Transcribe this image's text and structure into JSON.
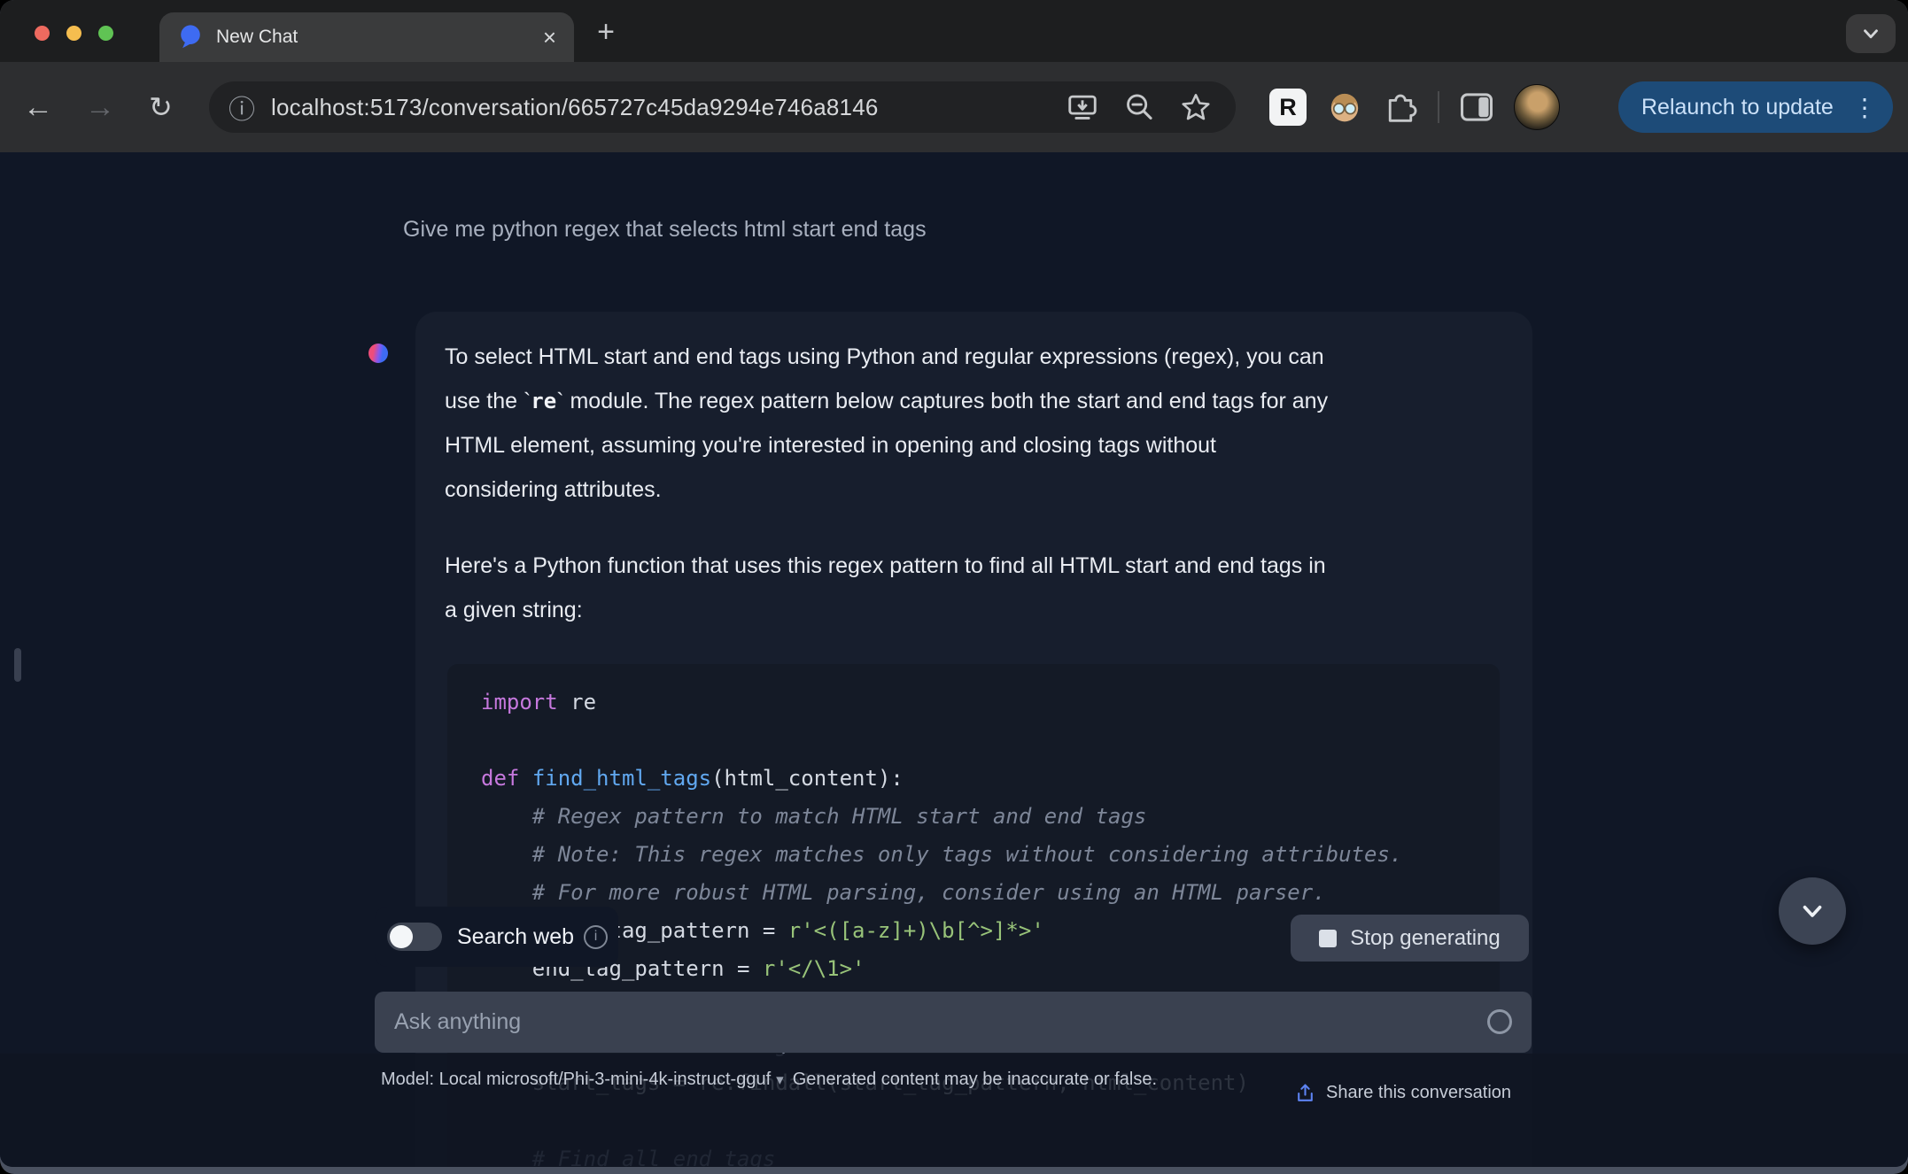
{
  "browser": {
    "tab": {
      "title": "New Chat",
      "close_glyph": "×",
      "new_tab_glyph": "+"
    },
    "toolbar": {
      "back_glyph": "←",
      "forward_glyph": "→",
      "reload_glyph": "↻",
      "info_glyph": "ⓘ",
      "url": "localhost:5173/conversation/665727c45da9294e746a8146",
      "extension_r_label": "R",
      "relaunch_label": "Relaunch to update",
      "menu_dots_glyph": "⋮"
    }
  },
  "chat": {
    "user_message": "Give me python regex that selects html start end tags",
    "assistant": {
      "p1_line1": "To select HTML start and end tags using Python and regular expressions (regex), you can",
      "p1_line2a": "use the `",
      "p1_line2_code": "re",
      "p1_line2b": "` module. The regex pattern below captures both the start and end tags for any",
      "p1_line3": "HTML element, assuming you're interested in opening and closing tags without",
      "p1_line4": "considering attributes.",
      "p2_line1": "Here's a Python function that uses this regex pattern to find all HTML start and end tags in",
      "p2_line2": "a given string:"
    },
    "code": {
      "language": "python",
      "lines": [
        [
          {
            "t": "import",
            "c": "kw"
          },
          {
            "t": " re",
            "c": "pl"
          }
        ],
        [],
        [
          {
            "t": "def",
            "c": "kw"
          },
          {
            "t": " ",
            "c": "pl"
          },
          {
            "t": "find_html_tags",
            "c": "fn"
          },
          {
            "t": "(html_content):",
            "c": "pl"
          }
        ],
        [
          {
            "t": "    # Regex pattern to match HTML start and end tags",
            "c": "cm"
          }
        ],
        [
          {
            "t": "    # Note: This regex matches only tags without considering attributes.",
            "c": "cm"
          }
        ],
        [
          {
            "t": "    # For more robust HTML parsing, consider using an HTML parser.",
            "c": "cm"
          }
        ],
        [
          {
            "t": "    start_tag_pattern = ",
            "c": "pl"
          },
          {
            "t": "r'<([a-z]+)\\b[^>]*>'",
            "c": "st"
          }
        ],
        [
          {
            "t": "    end_tag_pattern = ",
            "c": "pl"
          },
          {
            "t": "r'</\\1>'",
            "c": "st"
          }
        ],
        [],
        [
          {
            "t": "    # Find all start tags",
            "c": "cm"
          }
        ],
        [
          {
            "t": "    start_tags = re.findall(start_tag_pattern, html_content)",
            "c": "pl"
          }
        ],
        [],
        [
          {
            "t": "    # Find all end tags",
            "c": "cm"
          }
        ]
      ]
    },
    "controls": {
      "search_web_label": "Search web",
      "info_letter": "i",
      "stop_label": "Stop generating",
      "ask_placeholder": "Ask anything"
    },
    "footer": {
      "model": "Model: Local microsoft/Phi-3-mini-4k-instruct-gguf",
      "caret_glyph": "▾",
      "disclaimer": "Generated content may be inaccurate or false.",
      "share_label": "Share this conversation"
    }
  },
  "colors": {
    "accent_blue": "#3e6bf2",
    "relaunch_bg": "#1d4b78",
    "relaunch_text": "#cbe1f9",
    "page_bg": "#101726",
    "card_bg": "#171e2d",
    "code_bg": "#141a26",
    "string_green": "#98c379",
    "keyword_purple": "#c678dd",
    "function_blue": "#61a8f0",
    "share_icon_blue": "#5d83f2"
  }
}
